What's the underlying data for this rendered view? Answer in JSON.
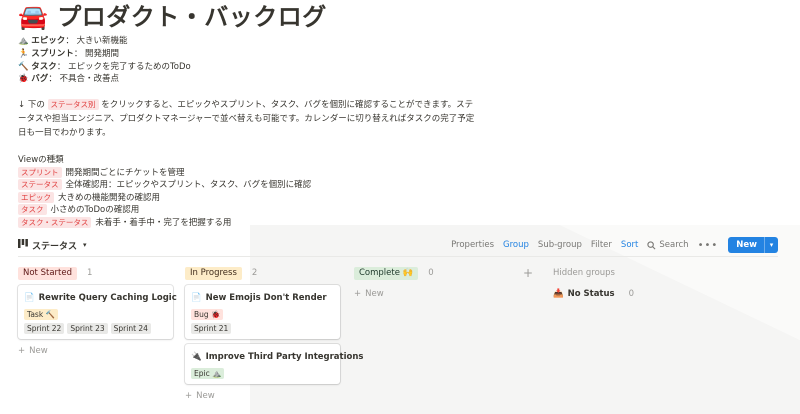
{
  "page": {
    "title_icon": "🚘",
    "title": "プロダクト・バックログ"
  },
  "legend": [
    {
      "icon": "⛰️",
      "label": "エピック",
      "desc": "大きい新機能"
    },
    {
      "icon": "🏃",
      "label": "スプリント",
      "desc": "開発期間"
    },
    {
      "icon": "🔨",
      "label": "タスク",
      "desc": "エピックを完了するためのToDo"
    },
    {
      "icon": "🐞",
      "label": "バグ",
      "desc": "不具合・改善点"
    }
  ],
  "description": {
    "arrow": "↓",
    "pre": "下の",
    "tag": "ステータス別",
    "post": "をクリックすると、エピックやスプリント、タスク、バグを個別に確認することができます。ステータスや担当エンジニア、プロダクトマネージャーで並べ替えも可能です。カレンダーに切り替えればタスクの完了予定日も一目でわかります。"
  },
  "views": {
    "title": "Viewの種類",
    "items": [
      {
        "tag": "スプリント",
        "desc": "開発期間ごとにチケットを管理"
      },
      {
        "tag": "ステータス",
        "desc": "全体確認用：エピックやスプリント、タスク、バグを個別に確認"
      },
      {
        "tag": "エピック",
        "desc": "大きめの機能開発の確認用"
      },
      {
        "tag": "タスク",
        "desc": "小さめのToDoの確認用"
      },
      {
        "tag": "タスク・ステータス",
        "desc": "未着手・着手中・完了を把握する用"
      }
    ]
  },
  "database": {
    "view_name": "ステータス",
    "toolbar": {
      "properties": "Properties",
      "group": "Group",
      "subgroup": "Sub-group",
      "filter": "Filter",
      "sort": "Sort",
      "search": "Search",
      "more": "•••",
      "new": "New"
    }
  },
  "board": {
    "columns": [
      {
        "name": "Not Started",
        "count": "1",
        "color_bg": "#ffe2dd",
        "color_fg": "#5d1715",
        "cards": [
          {
            "title": "Rewrite Query Caching Logic",
            "icon": "📄",
            "tags": [
              "Task 🔨"
            ],
            "sprints": [
              "Sprint 22",
              "Sprint 23",
              "Sprint 24"
            ]
          }
        ],
        "new_label": "New"
      },
      {
        "name": "In Progress",
        "count": "2",
        "color_bg": "#fdecc8",
        "color_fg": "#402c1b",
        "cards": [
          {
            "title": "New Emojis Don't Render",
            "icon": "📄",
            "tags": [
              "Bug 🐞"
            ],
            "sprints": [
              "Sprint 21"
            ]
          },
          {
            "title": "Improve Third Party Integrations",
            "icon": "🔌",
            "tags": [
              "Epic ⛰️"
            ],
            "sprints": []
          }
        ],
        "new_label": "New"
      },
      {
        "name": "Complete 🙌",
        "count": "0",
        "color_bg": "#dbeddb",
        "color_fg": "#1c3829",
        "cards": [],
        "new_label": "New"
      }
    ],
    "hidden_groups": {
      "title": "Hidden groups",
      "items": [
        {
          "icon": "📥",
          "label": "No Status",
          "count": "0"
        }
      ]
    }
  }
}
